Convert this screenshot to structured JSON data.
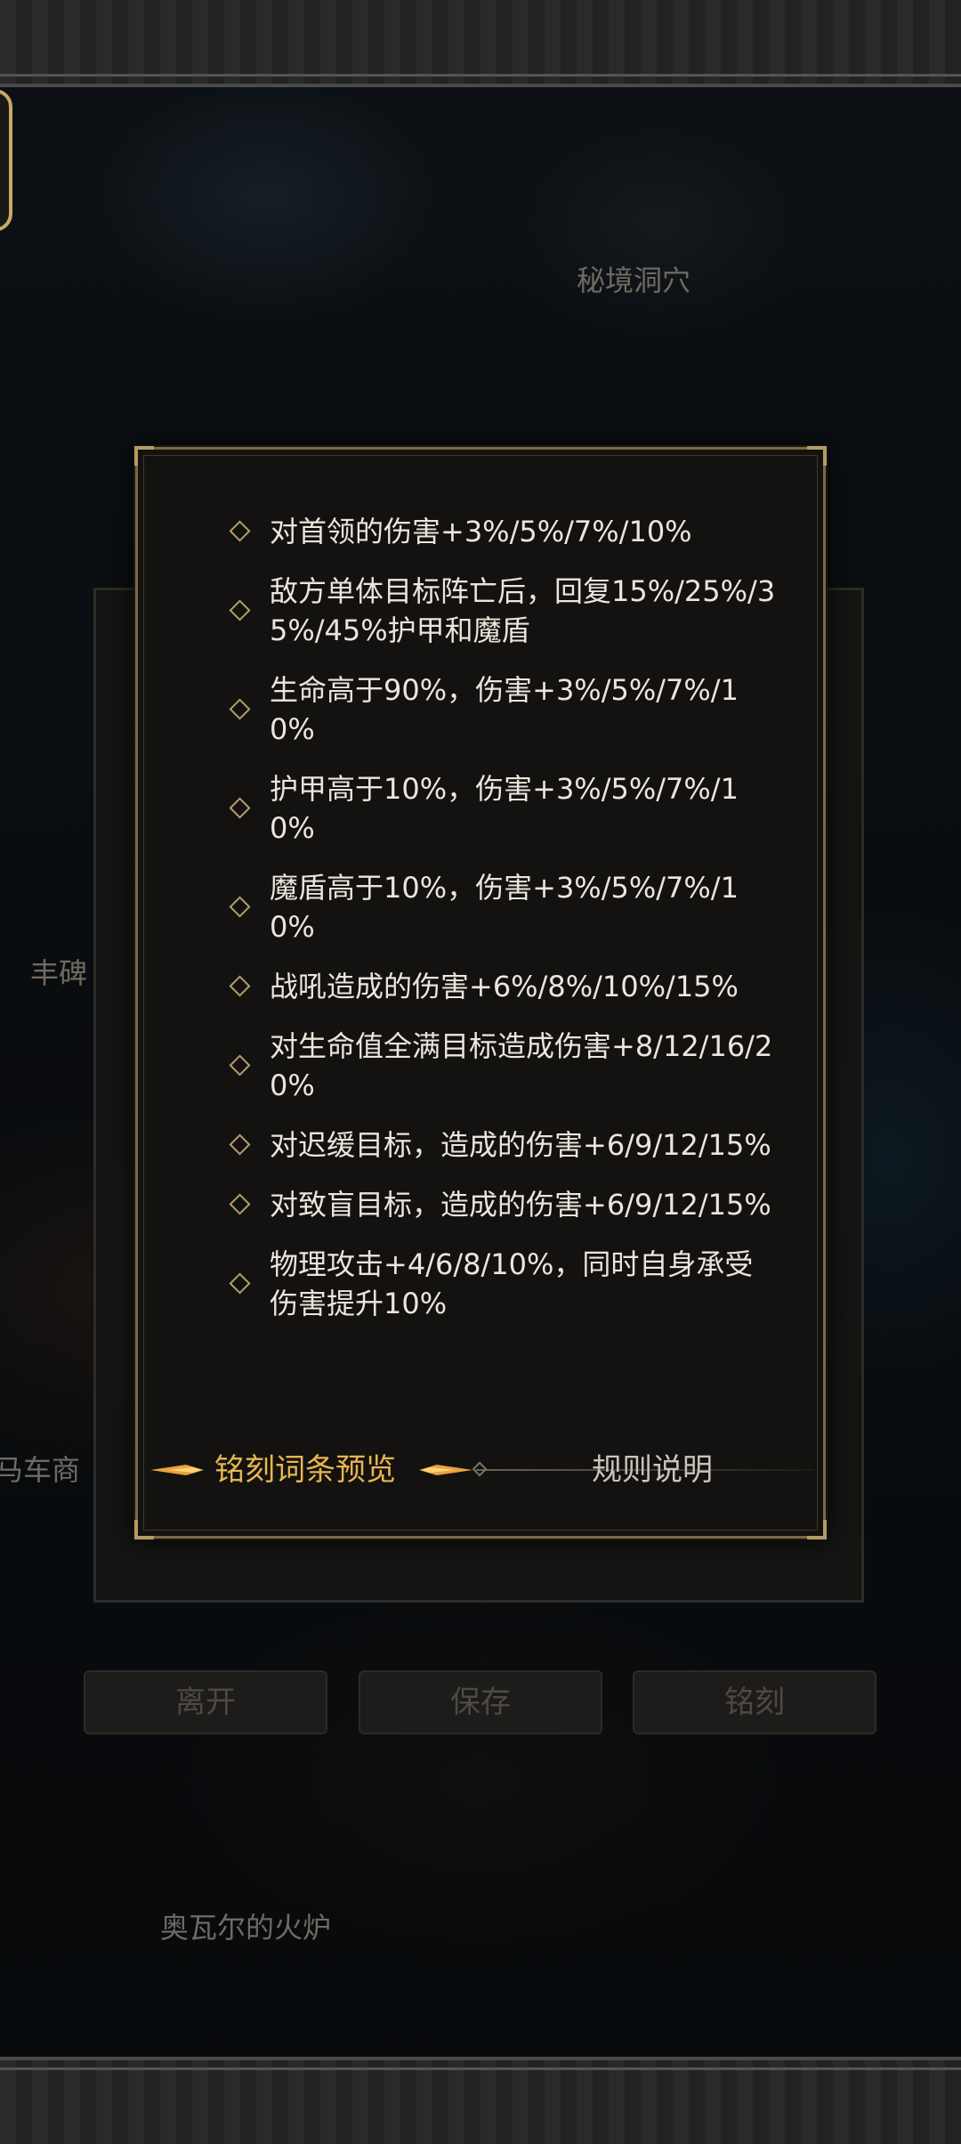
{
  "background": {
    "location_labels": {
      "secret_cave": "秘境洞穴",
      "monument": "丰碑",
      "carriage": "马车商",
      "forge": "奥瓦尔的火炉"
    },
    "buttons": {
      "leave": "离开",
      "save": "保存",
      "engrave": "铭刻"
    }
  },
  "modal": {
    "entries": [
      "对首领的伤害+3%/5%/7%/10%",
      "敌方单体目标阵亡后，回复15%/25%/35%/45%护甲和魔盾",
      "生命高于90%，伤害+3%/5%/7%/10%",
      "护甲高于10%，伤害+3%/5%/7%/10%",
      "魔盾高于10%，伤害+3%/5%/7%/10%",
      "战吼造成的伤害+6%/8%/10%/15%",
      "对生命值全满目标造成伤害+8/12/16/20%",
      "对迟缓目标，造成的伤害+6/9/12/15%",
      "对致盲目标，造成的伤害+6/9/12/15%",
      "物理攻击+4/6/8/10%，同时自身承受伤害提升10%"
    ],
    "tabs": {
      "preview": "铭刻词条预览",
      "rules": "规则说明"
    }
  },
  "colors": {
    "accent_gold": "#e7b64e",
    "border_gold": "#b49a66",
    "text": "#ebe6dc"
  }
}
